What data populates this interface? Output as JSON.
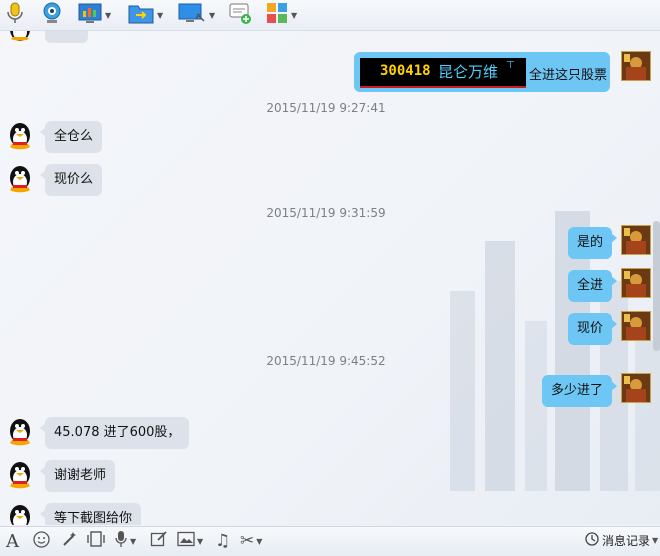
{
  "toolbar": {
    "icons": [
      "microphone-icon",
      "video-call-icon",
      "screen-share-icon",
      "file-transfer-icon",
      "remote-desktop-icon",
      "new-message-icon",
      "app-grid-icon"
    ]
  },
  "stock_card": {
    "code": "300418",
    "name": "昆仑万维",
    "message": "全进这只股票"
  },
  "timestamps": {
    "t1": "2015/11/19 9:27:41",
    "t2": "2015/11/19 9:31:59",
    "t3": "2015/11/19 9:45:52"
  },
  "messages": {
    "m1": "全仓么",
    "m2": "现价么",
    "m3": "是的",
    "m4": "全进",
    "m5": "现价",
    "m6": "多少进了",
    "m7": "45.078 进了600股，",
    "m8": "谢谢老师",
    "m9": "等下截图给你"
  },
  "bottom_toolbar": {
    "history_label": "消息记录"
  },
  "colors": {
    "outgoing_bubble": "#6ec6f5",
    "incoming_bubble": "#dde2ea",
    "stock_code": "#ffd200",
    "stock_name": "#4fd1ff"
  }
}
